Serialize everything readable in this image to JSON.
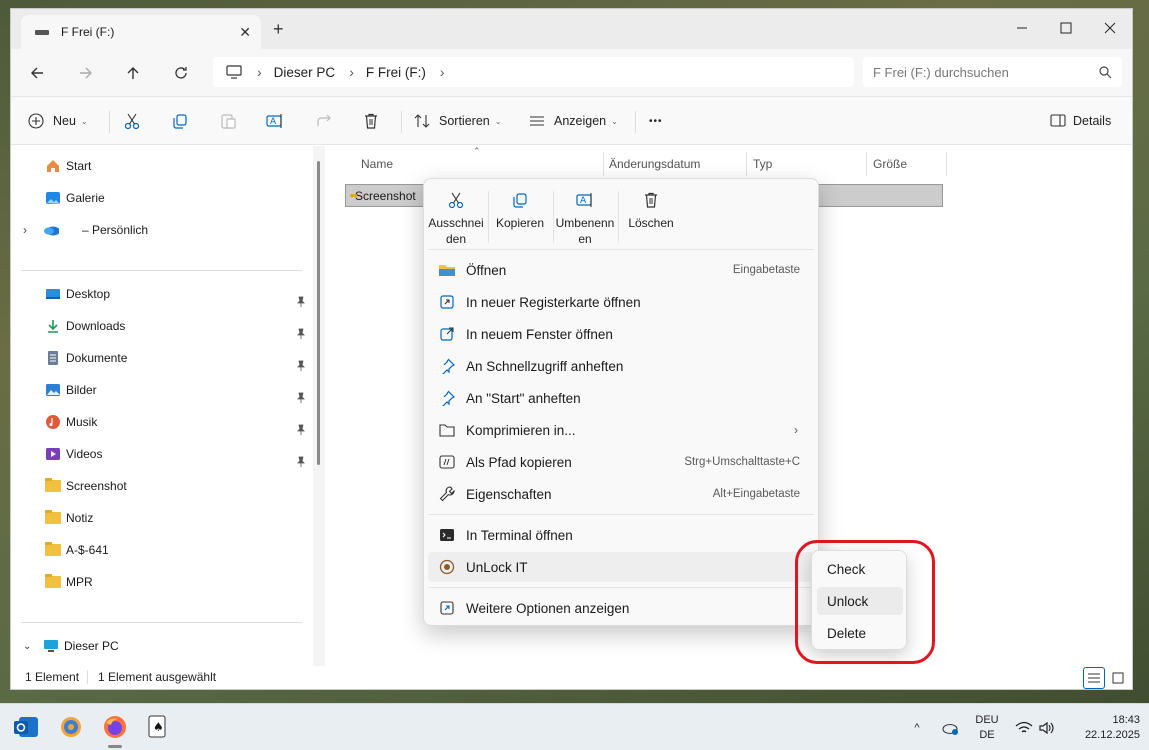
{
  "window": {
    "tab_title": "F Frei (F:)",
    "icons": {
      "drive": "drive-icon",
      "close": "close-icon",
      "new_tab": "plus-icon",
      "minimize": "minimize-icon",
      "maximize": "maximize-icon",
      "window_close": "close-icon"
    }
  },
  "tab": {
    "close_glyph": "✕",
    "new_glyph": "+"
  },
  "nav": {
    "breadcrumb": [
      "Dieser PC",
      "F Frei (F:)"
    ],
    "separator": "›",
    "search_placeholder": "F Frei (F:) durchsuchen"
  },
  "toolbar": {
    "new_label": "Neu",
    "sort_label": "Sortieren",
    "view_label": "Anzeigen",
    "more_label": "•••",
    "details_label": "Details",
    "caret": "⌄"
  },
  "sidebar": {
    "top_items": [
      {
        "label": "Start",
        "icon": "home-icon"
      },
      {
        "label": "Galerie",
        "icon": "gallery-icon"
      },
      {
        "label": "– Persönlich",
        "icon": "onedrive-icon"
      }
    ],
    "pinned_items": [
      {
        "label": "Desktop",
        "icon": "desktop-icon"
      },
      {
        "label": "Downloads",
        "icon": "download-icon"
      },
      {
        "label": "Dokumente",
        "icon": "documents-icon"
      },
      {
        "label": "Bilder",
        "icon": "pictures-icon"
      },
      {
        "label": "Musik",
        "icon": "music-icon"
      },
      {
        "label": "Videos",
        "icon": "videos-icon"
      }
    ],
    "folder_items": [
      {
        "label": "Screenshot"
      },
      {
        "label": "Notiz"
      },
      {
        "label": "A-$-641"
      },
      {
        "label": "MPR"
      }
    ],
    "this_pc_label": "Dieser PC"
  },
  "columns": {
    "name": "Name",
    "modified": "Änderungsdatum",
    "type": "Typ",
    "size": "Größe"
  },
  "files": [
    {
      "name": "Screenshot"
    }
  ],
  "context_menu": {
    "quick_actions": [
      {
        "label_line1": "Ausschnei",
        "label_line2": "den",
        "icon": "scissors-icon"
      },
      {
        "label_line1": "Kopieren",
        "label_line2": "",
        "icon": "copy-icon"
      },
      {
        "label_line1": "Umbenenn",
        "label_line2": "en",
        "icon": "rename-icon"
      },
      {
        "label_line1": "Löschen",
        "label_line2": "",
        "icon": "trash-icon"
      }
    ],
    "items": [
      {
        "label": "Öffnen",
        "accel": "Eingabetaste",
        "icon": "folder-icon"
      },
      {
        "label": "In neuer Registerkarte öffnen",
        "accel": "",
        "icon": "new-tab-icon"
      },
      {
        "label": "In neuem Fenster öffnen",
        "accel": "",
        "icon": "new-window-icon"
      },
      {
        "label": "An Schnellzugriff anheften",
        "accel": "",
        "icon": "pin-icon"
      },
      {
        "label": "An \"Start\" anheften",
        "accel": "",
        "icon": "pin-icon"
      },
      {
        "label": "Komprimieren in...",
        "accel": "",
        "icon": "archive-icon",
        "submenu_glyph": "›"
      },
      {
        "label": "Als Pfad kopieren",
        "accel": "Strg+Umschalttaste+C",
        "icon": "copy-path-icon"
      },
      {
        "label": "Eigenschaften",
        "accel": "Alt+Eingabetaste",
        "icon": "wrench-icon"
      }
    ],
    "terminal_label": "In Terminal öffnen",
    "unlock_label": "UnLock IT",
    "more_options_label": "Weitere Optionen anzeigen"
  },
  "submenu": {
    "items": [
      "Check",
      "Unlock",
      "Delete"
    ],
    "highlighted": "Unlock"
  },
  "statusbar": {
    "count": "1 Element",
    "selected": "1 Element ausgewählt"
  },
  "taskbar": {
    "lang_line1": "DEU",
    "lang_line2": "DE",
    "time": "18:43",
    "date": "22.12.2025",
    "chevron": "^"
  },
  "colors": {
    "accent": "#0067c0",
    "highlight_ring": "#e0151f",
    "folder": "#f0c040"
  }
}
